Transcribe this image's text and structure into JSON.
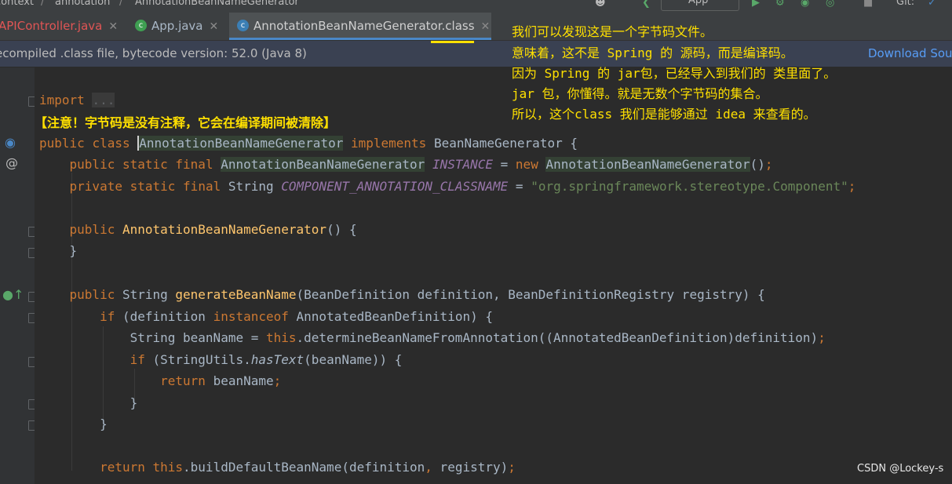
{
  "breadcrumbs": [
    "context",
    "annotation",
    "AnnotationBeanNameGenerator"
  ],
  "toolbar": {
    "run_config": "App",
    "git_label": "Git:"
  },
  "tabs": [
    {
      "label": "APIController.java",
      "color": "#e05555",
      "active": false
    },
    {
      "label": "App.java",
      "color": "#a9b7c6",
      "active": false
    },
    {
      "label": "AnnotationBeanNameGenerator.class",
      "color": "#d0d0d0",
      "active": true
    }
  ],
  "notice": {
    "text": "ecompiled .class file, bytecode version: 52.0 (Java 8)",
    "link": "Download Sou"
  },
  "overlay_note": [
    "我们可以发现这是一个字节码文件。",
    "意味着，这不是 Spring 的 源码，而是编译码。",
    "因为 Spring 的 jar包，已经导入到我们的 类里面了。",
    "jar 包，你懂得。就是无数个字节码的集合。",
    "所以，这个class 我们是能够通过 idea 来查看的。"
  ],
  "inline_note": "【注意！字节码是没有注释，它会在编译期间被清除】",
  "code": {
    "import_kw": "import",
    "import_fold": "...",
    "public": "public",
    "class": "class",
    "private": "private",
    "static": "static",
    "final": "final",
    "implements": "implements",
    "new": "new",
    "if": "if",
    "instanceof": "instanceof",
    "this": "this",
    "return": "return",
    "class_name": "AnnotationBeanNameGenerator",
    "interface_name": "BeanNameGenerator",
    "instance_field": "INSTANCE",
    "string_type": "String",
    "component_field": "COMPONENT_ANNOTATION_CLASSNAME",
    "component_value": "\"org.springframework.stereotype.Component\"",
    "method_name": "generateBeanName",
    "method_params": "(BeanDefinition definition, BeanDefinitionRegistry registry) {",
    "if1_rest": "(definition ",
    "annotated_def": "AnnotatedBeanDefinition) {",
    "bean_name_decl": "String beanName = ",
    "determine_call": ".determineBeanNameFromAnnotation((AnnotatedBeanDefinition)definition)",
    "stringutils": "(StringUtils.",
    "hastext": "hasText",
    "hastext_args": "(beanName)) {",
    "return_bean": "beanName",
    "build_default": ".buildDefaultBeanName(definition",
    "registry_arg": " registry)"
  },
  "watermark": "CSDN @Lockey-s"
}
